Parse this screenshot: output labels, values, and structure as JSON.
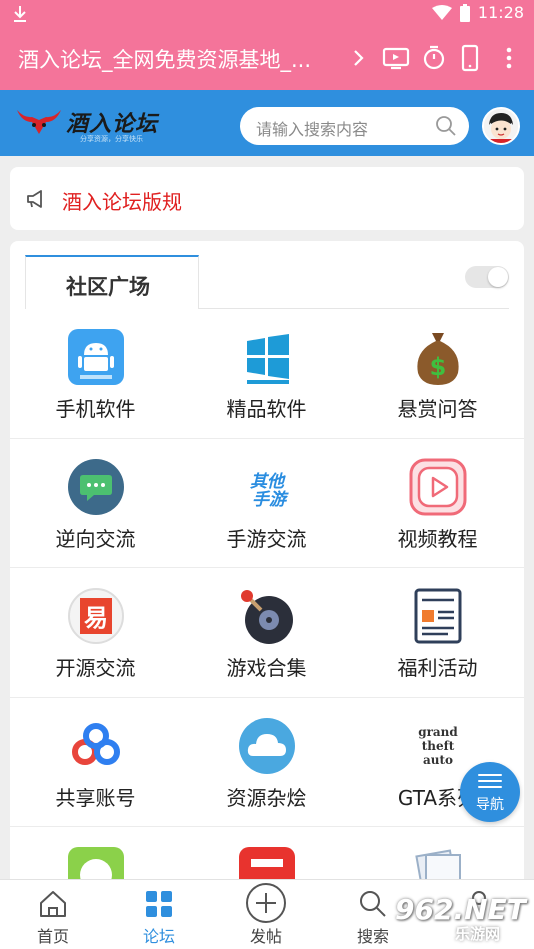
{
  "status_bar": {
    "time": "11:28"
  },
  "browser": {
    "title": "酒入论坛_全网免费资源基地_..."
  },
  "site": {
    "logo_text": "酒入论坛",
    "slogan": "分享资源，分享快乐",
    "search_placeholder": "请输入搜索内容"
  },
  "notice": {
    "text": "酒入论坛版规"
  },
  "section": {
    "tab_label": "社区广场"
  },
  "categories": [
    {
      "label": "手机软件",
      "icon": "android-icon"
    },
    {
      "label": "精品软件",
      "icon": "windows-icon"
    },
    {
      "label": "悬赏问答",
      "icon": "money-bag-icon"
    },
    {
      "label": "逆向交流",
      "icon": "chat-icon"
    },
    {
      "label": "手游交流",
      "icon": "mobile-game-icon"
    },
    {
      "label": "视频教程",
      "icon": "video-play-icon"
    },
    {
      "label": "开源交流",
      "icon": "open-source-icon"
    },
    {
      "label": "游戏合集",
      "icon": "game-disc-icon"
    },
    {
      "label": "福利活动",
      "icon": "newspaper-icon"
    },
    {
      "label": "共享账号",
      "icon": "share-link-icon"
    },
    {
      "label": "资源杂烩",
      "icon": "cloud-icon"
    },
    {
      "label": "GTA系列",
      "icon": "gta-logo-icon"
    }
  ],
  "fab": {
    "label": "导航"
  },
  "bottom_nav": [
    {
      "label": "首页",
      "icon": "home-icon",
      "active": false
    },
    {
      "label": "论坛",
      "icon": "grid-icon",
      "active": true
    },
    {
      "label": "发帖",
      "icon": "add-circle-icon",
      "active": false
    },
    {
      "label": "搜索",
      "icon": "search-icon",
      "active": false
    },
    {
      "label": "",
      "icon": "profile-icon",
      "active": false
    }
  ],
  "watermark": {
    "main": "962.NET",
    "sub": "乐游网"
  },
  "colors": {
    "status_bar": "#f4749a",
    "header": "#2f8fde",
    "notice_text": "#e02020",
    "active_tab": "#2f8fde"
  }
}
